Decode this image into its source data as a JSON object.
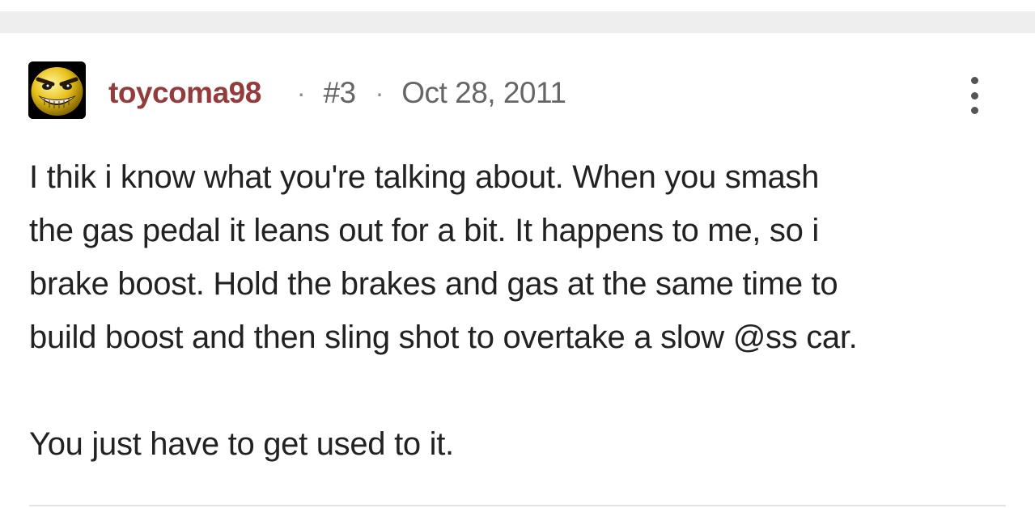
{
  "post": {
    "username": "toycoma98",
    "post_number": "#3",
    "date": "Oct 28, 2011",
    "separator": "·",
    "body_lines": [
      "I thik i know what you're talking about. When you smash",
      "the gas pedal it leans out for a bit. It happens to me, so i",
      "brake boost. Hold the brakes and gas at the same time to",
      "build boost and then sling shot to overtake a slow @ss car."
    ],
    "closing_line": "You just have to get used to it.",
    "avatar_icon": "grinning-face-avatar-icon",
    "menu_icon": "more-vertical-icon"
  },
  "colors": {
    "username": "#943c3c",
    "meta": "#666666",
    "body": "#222222",
    "band": "#eeeeee"
  }
}
